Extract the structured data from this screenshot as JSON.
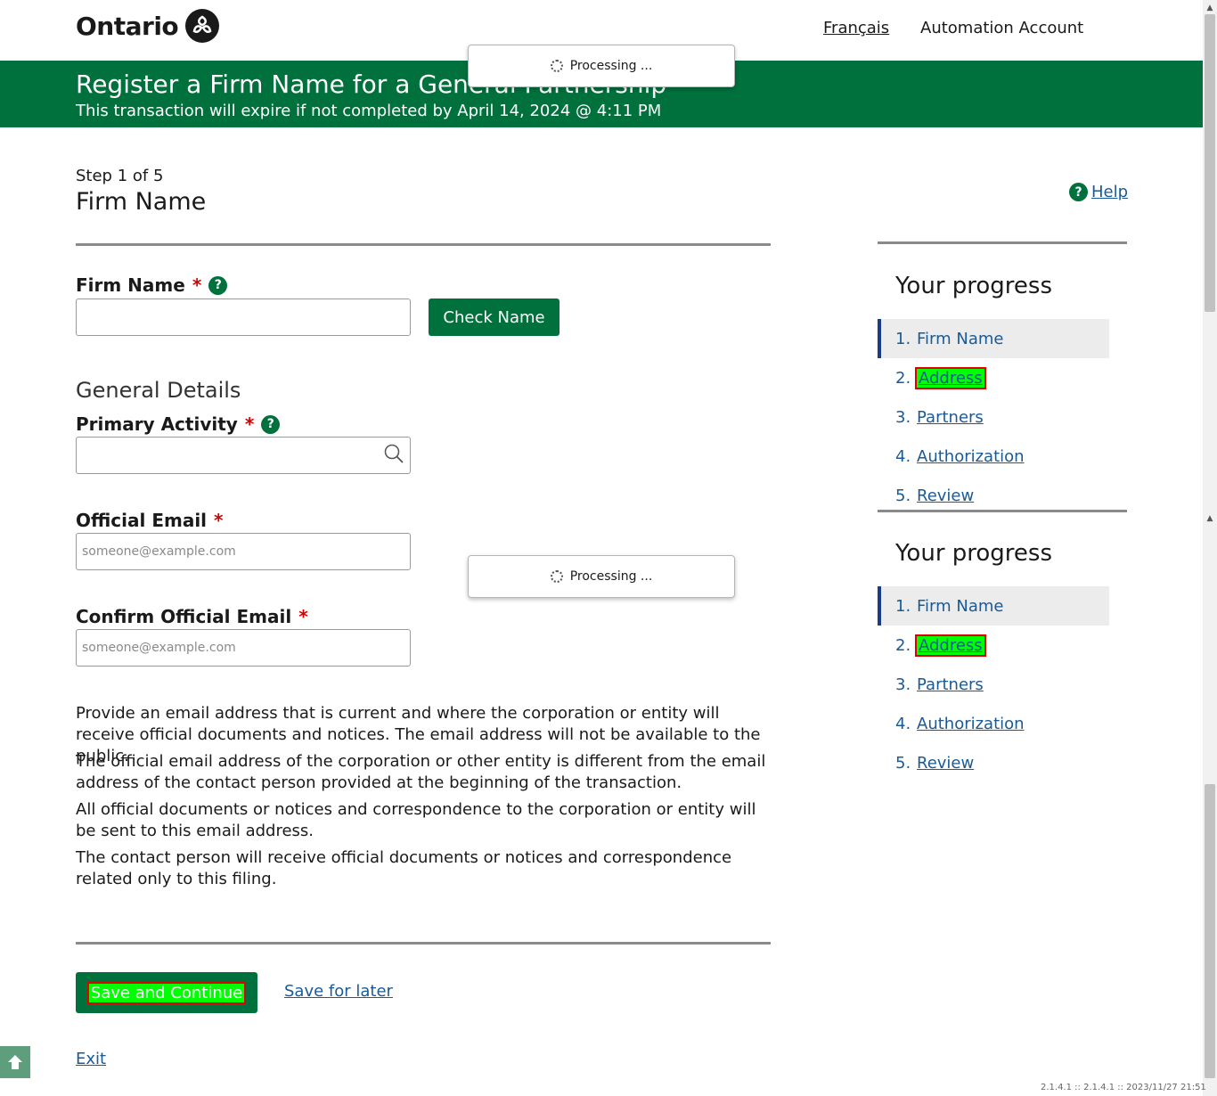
{
  "header": {
    "logo_text": "Ontario",
    "lang_link": "Français",
    "account": "Automation Account"
  },
  "banner": {
    "title": "Register a Firm Name for a General Partnership",
    "subtitle": "This transaction will expire if not completed by April 14, 2024 @ 4:11 PM"
  },
  "processing": {
    "text": "Processing ..."
  },
  "page": {
    "step": "Step 1 of 5",
    "title": "Firm Name",
    "help": "Help"
  },
  "form": {
    "firm_name_label": "Firm Name",
    "firm_name_value": "",
    "check_name_button": "Check Name",
    "general_details_title": "General Details",
    "primary_activity_label": "Primary Activity",
    "primary_activity_value": "",
    "official_email_label": "Official Email",
    "official_email_placeholder": "someone@example.com",
    "confirm_email_label": "Confirm Official Email",
    "confirm_email_placeholder": "someone@example.com",
    "required_marker": "*",
    "help_marker": "?"
  },
  "info_paragraphs": [
    "Provide an email address that is current and where the corporation or entity will receive official documents and notices. The email address will not be available to the public.",
    "The official email address of the corporation or other entity is different from the email address of the contact person provided at the beginning of the transaction.",
    "All official documents or notices and correspondence to the corporation or entity will be sent to this email address.",
    "The contact person will receive official documents or notices and correspondence related only to this filing."
  ],
  "actions": {
    "save_continue": "Save and Continue",
    "save_later": "Save for later",
    "exit": "Exit"
  },
  "progress": {
    "title": "Your progress",
    "items": [
      {
        "num": "1.",
        "label": "Firm Name"
      },
      {
        "num": "2.",
        "label": "Address"
      },
      {
        "num": "3.",
        "label": "Partners"
      },
      {
        "num": "4.",
        "label": "Authorization"
      },
      {
        "num": "5.",
        "label": "Review"
      }
    ]
  },
  "footer": {
    "version": "2.1.4.1 :: 2.1.4.1 :: 2023/11/27 21:51"
  },
  "colors": {
    "brand_green": "#00703c",
    "link_blue": "#1a5a96",
    "required_red": "#d40000",
    "highlight_green": "#00ff00"
  }
}
